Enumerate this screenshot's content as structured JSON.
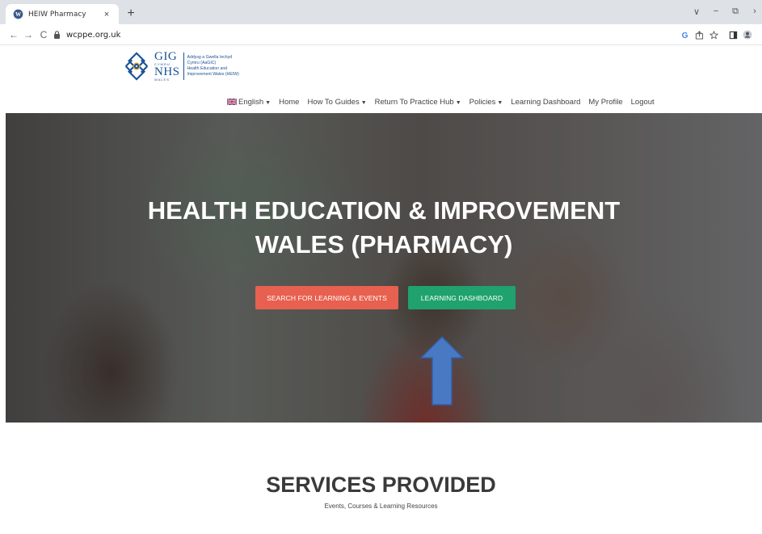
{
  "browser": {
    "tab_title": "HEIW Pharmacy",
    "tab_close": "×",
    "new_tab": "+",
    "url": "wcppe.org.uk",
    "nav": {
      "back": "←",
      "forward": "→",
      "reload": "C"
    },
    "window_controls": {
      "minimize": "−",
      "restore": "⧉",
      "more": "›",
      "dropdown": "∨"
    },
    "toolbar_icons": [
      "google-icon",
      "share-icon",
      "star-icon",
      "sidebar-icon",
      "profile-icon"
    ]
  },
  "logo": {
    "big1": "GIG",
    "small1": "CYMRU",
    "big2": "NHS",
    "small2": "WALES",
    "line1": "Addysg a Gwella Iechyd",
    "line2": "Cymru (AaGIC)",
    "line3": "Health Education and",
    "line4": "Improvement Wales (HEIW)"
  },
  "nav": {
    "language": "English",
    "home": "Home",
    "how_to": "How To Guides",
    "return": "Return To Practice Hub",
    "policies": "Policies",
    "dashboard": "Learning Dashboard",
    "profile": "My Profile",
    "logout": "Logout"
  },
  "hero": {
    "title_line1": "HEALTH EDUCATION & IMPROVEMENT",
    "title_line2": "WALES (PHARMACY)",
    "btn_search": "SEARCH FOR LEARNING & EVENTS",
    "btn_dashboard": "LEARNING DASHBOARD"
  },
  "services": {
    "title": "SERVICES PROVIDED",
    "subtitle": "Events, Courses & Learning Resources"
  },
  "colors": {
    "search_button": "#e8604f",
    "dashboard_button": "#1fa26d",
    "arrow": "#4a79c4",
    "brand_blue": "#1a5294"
  }
}
